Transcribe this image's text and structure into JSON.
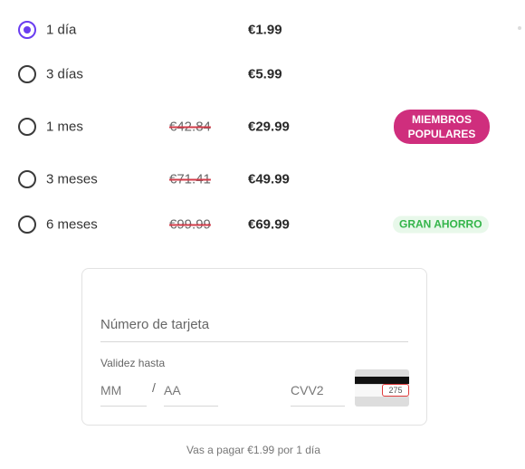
{
  "plans": [
    {
      "label": "1 día",
      "old_price": "",
      "price": "€1.99",
      "selected": true,
      "badge": ""
    },
    {
      "label": "3 días",
      "old_price": "",
      "price": "€5.99",
      "selected": false,
      "badge": ""
    },
    {
      "label": "1 mes",
      "old_price": "€42.84",
      "price": "€29.99",
      "selected": false,
      "badge": "MIEMBROS POPULARES"
    },
    {
      "label": "3 meses",
      "old_price": "€71.41",
      "price": "€49.99",
      "selected": false,
      "badge": ""
    },
    {
      "label": "6 meses",
      "old_price": "€99.99",
      "price": "€69.99",
      "selected": false,
      "badge": "GRAN AHORRO"
    }
  ],
  "payment": {
    "card_number_placeholder": "Número de tarjeta",
    "expiry_label": "Validez hasta",
    "month_placeholder": "MM",
    "separator": "/",
    "year_placeholder": "AA",
    "cvv_placeholder": "CVV2",
    "card_code_example": "275"
  },
  "summary": "Vas a pagar €1.99 por 1 día",
  "colors": {
    "accent": "#6a3df0",
    "popular_badge": "#cf2e7d",
    "saving_badge": "#34b54a",
    "strike": "#d23c4a"
  }
}
